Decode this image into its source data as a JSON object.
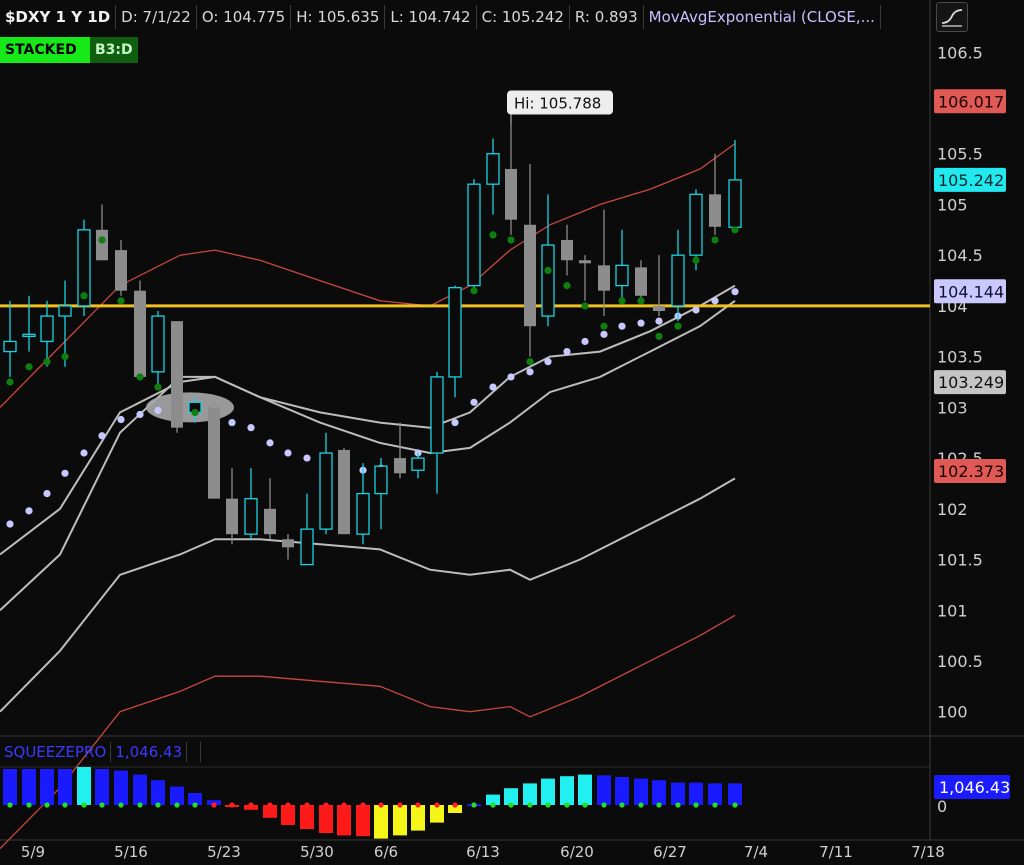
{
  "header": {
    "symbol": "$DXY 1 Y 1D",
    "date": "D: 7/1/22",
    "open": "O: 104.775",
    "high": "H: 105.635",
    "low": "L: 104.742",
    "close": "C: 105.242",
    "range": "R: 0.893",
    "study": "MovAvgExponential (CLOSE,..."
  },
  "badges": {
    "stacked": "STACKED",
    "b3": "B3:D"
  },
  "squeeze": {
    "name": "SQUEEZEPRO",
    "value": "1,046.43",
    "axis_value": "1,046.43",
    "axis_zero": "0"
  },
  "callout": {
    "text": "Hi: 105.788"
  },
  "price_tags": [
    {
      "text": "106.017",
      "value": 106.017,
      "bg": "#e05a55",
      "fg": "#1a0000"
    },
    {
      "text": "105.242",
      "value": 105.242,
      "bg": "#22e8f0",
      "fg": "#002a2a"
    },
    {
      "text": "104.144",
      "value": 104.144,
      "bg": "#cbc8ff",
      "fg": "#111133"
    },
    {
      "text": "103.249",
      "value": 103.249,
      "bg": "#c4c4c4",
      "fg": "#111111"
    },
    {
      "text": "102.373",
      "value": 102.373,
      "bg": "#e05a55",
      "fg": "#1a0000"
    }
  ],
  "colors": {
    "up_candle": "#19d3e0",
    "down_candle": "#8c8c8c",
    "outer_band": "#c8473d",
    "midline": "#bdbdbd",
    "sar_dot": "#c8c8ff",
    "signal_dot": "#0e7f0e",
    "horizontal_line": "#f0c020"
  },
  "chart_data": {
    "type": "candlestick",
    "title": "$DXY 1 Y 1D",
    "y_ticks": [
      106.5,
      106,
      105.5,
      105,
      104.5,
      104,
      103.5,
      103,
      102.5,
      102,
      101.5,
      101,
      100.5,
      100
    ],
    "ylim": [
      99.8,
      106.7
    ],
    "x_ticks": [
      "5/9",
      "5/16",
      "5/23",
      "5/30",
      "6/6",
      "6/13",
      "6/20",
      "6/27",
      "7/4",
      "7/11",
      "7/18"
    ],
    "horizontal_line": 104.0,
    "candles": [
      {
        "x": 10,
        "o": 103.55,
        "h": 104.05,
        "l": 103.3,
        "c": 103.65
      },
      {
        "x": 29,
        "o": 103.7,
        "h": 104.1,
        "l": 103.55,
        "c": 103.72
      },
      {
        "x": 47,
        "o": 103.65,
        "h": 104.05,
        "l": 103.4,
        "c": 103.9
      },
      {
        "x": 65,
        "o": 103.9,
        "h": 104.25,
        "l": 103.4,
        "c": 104.0
      },
      {
        "x": 84,
        "o": 104.0,
        "h": 104.85,
        "l": 103.9,
        "c": 104.75
      },
      {
        "x": 102,
        "o": 104.75,
        "h": 105.0,
        "l": 104.45,
        "c": 104.45
      },
      {
        "x": 121,
        "o": 104.55,
        "h": 104.65,
        "l": 104.1,
        "c": 104.15
      },
      {
        "x": 140,
        "o": 104.15,
        "h": 104.25,
        "l": 103.3,
        "c": 103.3
      },
      {
        "x": 158,
        "o": 103.35,
        "h": 103.95,
        "l": 103.2,
        "c": 103.9
      },
      {
        "x": 177,
        "o": 103.85,
        "h": 103.85,
        "l": 102.75,
        "c": 102.8
      },
      {
        "x": 195,
        "o": 102.95,
        "h": 103.1,
        "l": 102.85,
        "c": 103.05
      },
      {
        "x": 214,
        "o": 103.0,
        "h": 103.05,
        "l": 102.1,
        "c": 102.1
      },
      {
        "x": 232,
        "o": 102.1,
        "h": 102.4,
        "l": 101.65,
        "c": 101.75
      },
      {
        "x": 251,
        "o": 101.75,
        "h": 102.4,
        "l": 101.7,
        "c": 102.1
      },
      {
        "x": 270,
        "o": 102.0,
        "h": 102.3,
        "l": 101.7,
        "c": 101.75
      },
      {
        "x": 288,
        "o": 101.7,
        "h": 101.75,
        "l": 101.5,
        "c": 101.62
      },
      {
        "x": 307,
        "o": 101.45,
        "h": 102.15,
        "l": 101.45,
        "c": 101.8
      },
      {
        "x": 326,
        "o": 101.8,
        "h": 102.75,
        "l": 101.75,
        "c": 102.55
      },
      {
        "x": 344,
        "o": 102.58,
        "h": 102.6,
        "l": 101.75,
        "c": 101.75
      },
      {
        "x": 363,
        "o": 101.75,
        "h": 102.45,
        "l": 101.65,
        "c": 102.15
      },
      {
        "x": 381,
        "o": 102.15,
        "h": 102.5,
        "l": 101.8,
        "c": 102.42
      },
      {
        "x": 400,
        "o": 102.5,
        "h": 102.85,
        "l": 102.3,
        "c": 102.35
      },
      {
        "x": 418,
        "o": 102.38,
        "h": 102.55,
        "l": 102.3,
        "c": 102.5
      },
      {
        "x": 437,
        "o": 102.55,
        "h": 103.35,
        "l": 102.15,
        "c": 103.3
      },
      {
        "x": 455,
        "o": 103.3,
        "h": 104.2,
        "l": 103.1,
        "c": 104.18
      },
      {
        "x": 474,
        "o": 104.2,
        "h": 105.25,
        "l": 104.15,
        "c": 105.2
      },
      {
        "x": 493,
        "o": 105.2,
        "h": 105.65,
        "l": 104.9,
        "c": 105.5
      },
      {
        "x": 511,
        "o": 105.35,
        "h": 105.79,
        "l": 104.7,
        "c": 104.85
      },
      {
        "x": 530,
        "o": 104.8,
        "h": 105.4,
        "l": 103.5,
        "c": 103.8
      },
      {
        "x": 548,
        "o": 103.9,
        "h": 105.1,
        "l": 103.8,
        "c": 104.6
      },
      {
        "x": 567,
        "o": 104.65,
        "h": 104.8,
        "l": 104.3,
        "c": 104.45
      },
      {
        "x": 585,
        "o": 104.45,
        "h": 104.5,
        "l": 104.05,
        "c": 104.42
      },
      {
        "x": 604,
        "o": 104.4,
        "h": 104.95,
        "l": 103.9,
        "c": 104.15
      },
      {
        "x": 622,
        "o": 104.2,
        "h": 104.75,
        "l": 104.05,
        "c": 104.4
      },
      {
        "x": 641,
        "o": 104.38,
        "h": 104.45,
        "l": 104.05,
        "c": 104.1
      },
      {
        "x": 659,
        "o": 104.0,
        "h": 104.5,
        "l": 103.9,
        "c": 103.95
      },
      {
        "x": 678,
        "o": 104.0,
        "h": 104.75,
        "l": 103.85,
        "c": 104.5
      },
      {
        "x": 696,
        "o": 104.5,
        "h": 105.15,
        "l": 104.35,
        "c": 105.1
      },
      {
        "x": 715,
        "o": 105.1,
        "h": 105.5,
        "l": 104.7,
        "c": 104.78
      },
      {
        "x": 735,
        "o": 104.775,
        "h": 105.635,
        "l": 104.742,
        "c": 105.242
      }
    ],
    "signal_dots": [
      [
        10,
        103.25
      ],
      [
        29,
        103.4
      ],
      [
        47,
        103.45
      ],
      [
        65,
        103.5
      ],
      [
        84,
        104.1
      ],
      [
        102,
        104.65
      ],
      [
        121,
        104.05
      ],
      [
        140,
        103.3
      ],
      [
        158,
        103.2
      ],
      [
        195,
        102.95
      ],
      [
        474,
        104.15
      ],
      [
        493,
        104.7
      ],
      [
        511,
        104.65
      ],
      [
        530,
        103.45
      ],
      [
        548,
        104.35
      ],
      [
        567,
        104.2
      ],
      [
        585,
        104.0
      ],
      [
        604,
        103.8
      ],
      [
        622,
        104.05
      ],
      [
        641,
        104.05
      ],
      [
        659,
        103.7
      ],
      [
        678,
        103.8
      ],
      [
        696,
        104.45
      ],
      [
        715,
        104.65
      ],
      [
        735,
        104.75
      ]
    ],
    "sar_dots": [
      [
        10,
        101.85
      ],
      [
        29,
        101.98
      ],
      [
        47,
        102.15
      ],
      [
        65,
        102.35
      ],
      [
        84,
        102.55
      ],
      [
        102,
        102.72
      ],
      [
        121,
        102.88
      ],
      [
        140,
        102.93
      ],
      [
        158,
        102.97
      ],
      [
        177,
        103.0
      ],
      [
        195,
        103.0
      ],
      [
        214,
        102.97
      ],
      [
        232,
        102.85
      ],
      [
        251,
        102.8
      ],
      [
        270,
        102.65
      ],
      [
        288,
        102.55
      ],
      [
        307,
        102.5
      ],
      [
        326,
        102.45
      ],
      [
        344,
        102.42
      ],
      [
        363,
        102.38
      ],
      [
        381,
        102.4
      ],
      [
        400,
        102.45
      ],
      [
        418,
        102.55
      ],
      [
        437,
        102.68
      ],
      [
        455,
        102.85
      ],
      [
        474,
        103.05
      ],
      [
        493,
        103.2
      ],
      [
        511,
        103.3
      ],
      [
        530,
        103.35
      ],
      [
        548,
        103.45
      ],
      [
        567,
        103.55
      ],
      [
        585,
        103.65
      ],
      [
        604,
        103.72
      ],
      [
        622,
        103.8
      ],
      [
        641,
        103.83
      ],
      [
        659,
        103.85
      ],
      [
        678,
        103.9
      ],
      [
        696,
        103.96
      ],
      [
        715,
        104.05
      ],
      [
        735,
        104.14
      ]
    ],
    "upper_band": [
      [
        0,
        101.55
      ],
      [
        60,
        102.0
      ],
      [
        120,
        102.95
      ],
      [
        180,
        103.25
      ],
      [
        215,
        103.3
      ],
      [
        260,
        103.1
      ],
      [
        320,
        102.85
      ],
      [
        380,
        102.65
      ],
      [
        430,
        102.55
      ],
      [
        470,
        102.6
      ],
      [
        510,
        102.85
      ],
      [
        550,
        103.15
      ],
      [
        600,
        103.3
      ],
      [
        650,
        103.55
      ],
      [
        700,
        103.8
      ],
      [
        735,
        104.05
      ]
    ],
    "midline": [
      [
        0,
        103.0
      ],
      [
        60,
        103.6
      ],
      [
        120,
        104.2
      ],
      [
        180,
        104.5
      ],
      [
        215,
        104.55
      ],
      [
        260,
        104.45
      ],
      [
        320,
        104.25
      ],
      [
        380,
        104.05
      ],
      [
        430,
        104.0
      ],
      [
        470,
        104.2
      ],
      [
        510,
        104.55
      ],
      [
        550,
        104.8
      ],
      [
        600,
        105.0
      ],
      [
        650,
        105.15
      ],
      [
        700,
        105.35
      ],
      [
        735,
        105.6
      ]
    ],
    "lower_band": [
      [
        0,
        100.0
      ],
      [
        60,
        100.6
      ],
      [
        120,
        101.35
      ],
      [
        180,
        101.55
      ],
      [
        215,
        101.7
      ],
      [
        260,
        101.7
      ],
      [
        320,
        101.65
      ],
      [
        380,
        101.6
      ],
      [
        430,
        101.4
      ],
      [
        470,
        101.35
      ],
      [
        510,
        101.4
      ],
      [
        530,
        101.3
      ],
      [
        580,
        101.5
      ],
      [
        640,
        101.8
      ],
      [
        700,
        102.1
      ],
      [
        735,
        102.3
      ]
    ],
    "ema_upper": [
      [
        0,
        101.0
      ],
      [
        60,
        101.55
      ],
      [
        120,
        102.75
      ],
      [
        180,
        103.3
      ],
      [
        215,
        103.3
      ],
      [
        260,
        103.1
      ],
      [
        320,
        102.95
      ],
      [
        380,
        102.85
      ],
      [
        430,
        102.8
      ],
      [
        470,
        102.95
      ],
      [
        510,
        103.3
      ],
      [
        550,
        103.5
      ],
      [
        600,
        103.55
      ],
      [
        650,
        103.75
      ],
      [
        700,
        104.0
      ],
      [
        735,
        104.2
      ]
    ],
    "squeeze_bars": [
      {
        "x": 10,
        "v": 900,
        "c": "#1a1aff"
      },
      {
        "x": 29,
        "v": 900,
        "c": "#1a1aff"
      },
      {
        "x": 47,
        "v": 900,
        "c": "#1a1aff"
      },
      {
        "x": 65,
        "v": 900,
        "c": "#1a1aff"
      },
      {
        "x": 84,
        "v": 950,
        "c": "#22f0f0"
      },
      {
        "x": 102,
        "v": 900,
        "c": "#1a1aff"
      },
      {
        "x": 121,
        "v": 860,
        "c": "#1a1aff"
      },
      {
        "x": 140,
        "v": 760,
        "c": "#1a1aff"
      },
      {
        "x": 158,
        "v": 620,
        "c": "#1a1aff"
      },
      {
        "x": 177,
        "v": 460,
        "c": "#1a1aff"
      },
      {
        "x": 195,
        "v": 300,
        "c": "#1a1aff"
      },
      {
        "x": 214,
        "v": 120,
        "c": "#1a1aff"
      },
      {
        "x": 232,
        "v": -40,
        "c": "#ff1a1a"
      },
      {
        "x": 251,
        "v": -120,
        "c": "#ff1a1a"
      },
      {
        "x": 270,
        "v": -320,
        "c": "#ff1a1a"
      },
      {
        "x": 288,
        "v": -500,
        "c": "#ff1a1a"
      },
      {
        "x": 307,
        "v": -600,
        "c": "#ff1a1a"
      },
      {
        "x": 326,
        "v": -700,
        "c": "#ff1a1a"
      },
      {
        "x": 344,
        "v": -760,
        "c": "#ff1a1a"
      },
      {
        "x": 363,
        "v": -780,
        "c": "#ff1a1a"
      },
      {
        "x": 381,
        "v": -840,
        "c": "#f5f51a"
      },
      {
        "x": 400,
        "v": -760,
        "c": "#f5f51a"
      },
      {
        "x": 418,
        "v": -640,
        "c": "#f5f51a"
      },
      {
        "x": 437,
        "v": -440,
        "c": "#f5f51a"
      },
      {
        "x": 455,
        "v": -200,
        "c": "#f5f51a"
      },
      {
        "x": 474,
        "v": 20,
        "c": "#1a1aff"
      },
      {
        "x": 493,
        "v": 260,
        "c": "#22f0f0"
      },
      {
        "x": 511,
        "v": 420,
        "c": "#22f0f0"
      },
      {
        "x": 530,
        "v": 540,
        "c": "#22f0f0"
      },
      {
        "x": 548,
        "v": 660,
        "c": "#22f0f0"
      },
      {
        "x": 567,
        "v": 720,
        "c": "#22f0f0"
      },
      {
        "x": 585,
        "v": 760,
        "c": "#22f0f0"
      },
      {
        "x": 604,
        "v": 740,
        "c": "#1a1aff"
      },
      {
        "x": 622,
        "v": 700,
        "c": "#1a1aff"
      },
      {
        "x": 641,
        "v": 660,
        "c": "#1a1aff"
      },
      {
        "x": 659,
        "v": 620,
        "c": "#1a1aff"
      },
      {
        "x": 678,
        "v": 560,
        "c": "#1a1aff"
      },
      {
        "x": 696,
        "v": 560,
        "c": "#1a1aff"
      },
      {
        "x": 715,
        "v": 540,
        "c": "#1a1aff"
      },
      {
        "x": 735,
        "v": 540,
        "c": "#1a1aff"
      }
    ]
  }
}
